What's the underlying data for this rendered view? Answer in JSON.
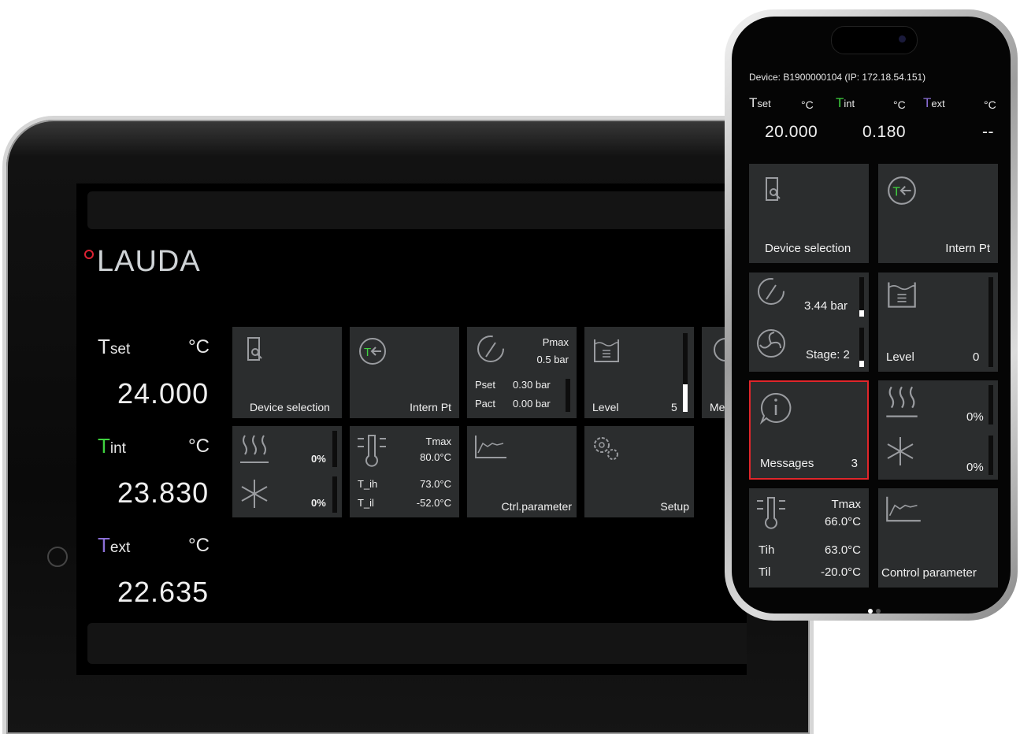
{
  "tablet": {
    "logo": "LAUDA",
    "temps": [
      {
        "symbol": "T",
        "sub": "set",
        "unit": "°C",
        "value": "24.000",
        "color": "#e8e8e8"
      },
      {
        "symbol": "T",
        "sub": "int",
        "unit": "°C",
        "value": "23.830",
        "color": "#3fd23f"
      },
      {
        "symbol": "T",
        "sub": "ext",
        "unit": "°C",
        "value": "22.635",
        "color": "#8b6fd6"
      }
    ],
    "tiles": {
      "device_selection": "Device selection",
      "intern_pt": "Intern Pt",
      "pmax_label": "Pmax",
      "pmax_value": "0.5 bar",
      "pset_label": "Pset",
      "pset_value": "0.30 bar",
      "pact_label": "Pact",
      "pact_value": "0.00 bar",
      "level_label": "Level",
      "level_value": "5",
      "level_fill": 0.35,
      "messages_partial": "Me",
      "heat_pct": "0%",
      "cool_pct": "0%",
      "tmax_label": "Tmax",
      "tmax_value": "80.0°C",
      "tih_label": "T_ih",
      "tih_value": "73.0°C",
      "til_label": "T_il",
      "til_value": "-52.0°C",
      "ctrl_parameter": "Ctrl.parameter",
      "setup": "Setup"
    }
  },
  "phone": {
    "device": "Device: B1900000104 (IP: 172.18.54.151)",
    "headers": [
      {
        "symbol": "T",
        "sub": "set",
        "unit": "°C",
        "value": "20.000",
        "color": "#e8e8e8"
      },
      {
        "symbol": "T",
        "sub": "int",
        "unit": "°C",
        "value": "0.180",
        "color": "#3fd23f"
      },
      {
        "symbol": "T",
        "sub": "ext",
        "unit": "°C",
        "value": "--",
        "color": "#8b6fd6"
      }
    ],
    "tiles": {
      "device_selection": "Device selection",
      "intern_pt": "Intern Pt",
      "pressure": "3.44 bar",
      "stage": "Stage: 2",
      "level_label": "Level",
      "level_value": "0",
      "messages_label": "Messages",
      "messages_count": "3",
      "heat_pct": "0%",
      "cool_pct": "0%",
      "tmax_label": "Tmax",
      "tmax_value": "66.0°C",
      "tih_label": "Tih",
      "tih_value": "63.0°C",
      "til_label": "Til",
      "til_value": "-20.0°C",
      "control_parameter": "Control parameter"
    }
  },
  "colors": {
    "tile_bg": "#2b2d2e",
    "highlight": "#e0262b",
    "accent_green": "#3fd23f",
    "accent_purple": "#8b6fd6",
    "logo_dot": "#dd2233"
  }
}
